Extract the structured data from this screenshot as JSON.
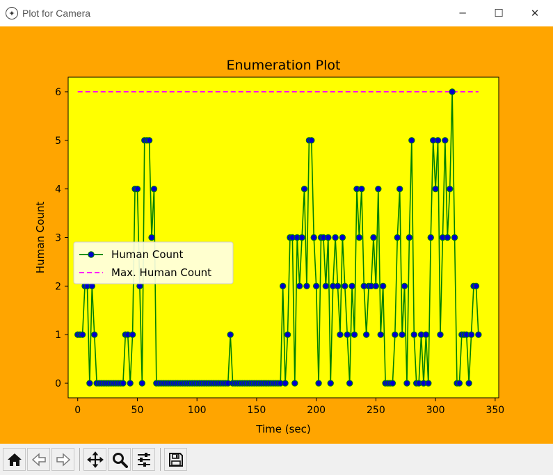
{
  "window": {
    "title": "Plot for Camera",
    "controls": [
      "─",
      "☐",
      "✕"
    ]
  },
  "colors": {
    "figure_bg": "#FFA500",
    "axes_bg": "#FFFF00",
    "series_line": "#008000",
    "series_marker": "#0000CC",
    "max_line": "#FF00FF"
  },
  "chart_data": {
    "type": "line",
    "title": "Enumeration Plot",
    "xlabel": "Time (sec)",
    "ylabel": "Human Count",
    "xlim": [
      -8,
      353
    ],
    "ylim": [
      -0.3,
      6.3
    ],
    "xticks": [
      0,
      50,
      100,
      150,
      200,
      250,
      300,
      350
    ],
    "yticks": [
      0,
      1,
      2,
      3,
      4,
      5,
      6
    ],
    "grid": false,
    "legend_position": "center-left",
    "series": [
      {
        "name": "Human Count",
        "style": "line-with-circle-markers",
        "x": [
          0,
          2,
          4,
          6,
          8,
          10,
          12,
          14,
          16,
          18,
          20,
          22,
          24,
          26,
          28,
          30,
          32,
          34,
          36,
          38,
          40,
          42,
          44,
          46,
          48,
          50,
          52,
          54,
          56,
          58,
          60,
          62,
          64,
          66,
          68,
          70,
          72,
          74,
          76,
          78,
          80,
          82,
          84,
          86,
          88,
          90,
          92,
          94,
          96,
          98,
          100,
          102,
          104,
          106,
          108,
          110,
          112,
          114,
          116,
          118,
          120,
          122,
          124,
          126,
          128,
          130,
          132,
          134,
          136,
          138,
          140,
          142,
          144,
          146,
          148,
          150,
          152,
          154,
          156,
          158,
          160,
          162,
          164,
          166,
          168,
          170,
          172,
          174,
          176,
          178,
          180,
          182,
          184,
          186,
          188,
          190,
          192,
          194,
          196,
          198,
          200,
          202,
          204,
          206,
          208,
          210,
          212,
          214,
          216,
          218,
          220,
          222,
          224,
          226,
          228,
          230,
          232,
          234,
          236,
          238,
          240,
          242,
          244,
          246,
          248,
          250,
          252,
          254,
          256,
          258,
          260,
          262,
          264,
          266,
          268,
          270,
          272,
          274,
          276,
          278,
          280,
          282,
          284,
          286,
          288,
          290,
          292,
          294,
          296,
          298,
          300,
          302,
          304,
          306,
          308,
          310,
          312,
          314,
          316,
          318,
          320,
          322,
          324,
          326,
          328,
          330,
          332,
          334,
          336
        ],
        "y": [
          1,
          1,
          1,
          2,
          2,
          0,
          2,
          1,
          0,
          0,
          0,
          0,
          0,
          0,
          0,
          0,
          0,
          0,
          0,
          0,
          1,
          1,
          0,
          1,
          4,
          4,
          2,
          0,
          5,
          5,
          5,
          3,
          4,
          0,
          0,
          0,
          0,
          0,
          0,
          0,
          0,
          0,
          0,
          0,
          0,
          0,
          0,
          0,
          0,
          0,
          0,
          0,
          0,
          0,
          0,
          0,
          0,
          0,
          0,
          0,
          0,
          0,
          0,
          0,
          1,
          0,
          0,
          0,
          0,
          0,
          0,
          0,
          0,
          0,
          0,
          0,
          0,
          0,
          0,
          0,
          0,
          0,
          0,
          0,
          0,
          0,
          2,
          0,
          1,
          3,
          3,
          0,
          3,
          2,
          3,
          4,
          2,
          5,
          5,
          3,
          2,
          0,
          3,
          3,
          2,
          3,
          0,
          2,
          3,
          2,
          1,
          3,
          2,
          1,
          0,
          2,
          1,
          4,
          3,
          4,
          2,
          1,
          2,
          2,
          3,
          2,
          4,
          1,
          2,
          0,
          0,
          0,
          0,
          1,
          3,
          4,
          1,
          2,
          0,
          3,
          5,
          1,
          0,
          0,
          1,
          0,
          1,
          0,
          3,
          5,
          4,
          5,
          1,
          3,
          5,
          3,
          4,
          6,
          3,
          0,
          0,
          1,
          1,
          1,
          0,
          1,
          2,
          2,
          1
        ],
        "color": "#008000",
        "marker_color": "#0000CC"
      },
      {
        "name": "Max. Human Count",
        "style": "dashed",
        "x": [
          0,
          336
        ],
        "y": [
          6,
          6
        ],
        "color": "#FF00FF"
      }
    ]
  },
  "toolbar": {
    "buttons": [
      {
        "icon": "home-icon"
      },
      {
        "icon": "back-arrow-icon"
      },
      {
        "icon": "forward-arrow-icon"
      },
      {
        "icon": "pan-icon"
      },
      {
        "icon": "zoom-icon"
      },
      {
        "icon": "subplots-config-icon"
      },
      {
        "icon": "save-icon"
      }
    ]
  }
}
